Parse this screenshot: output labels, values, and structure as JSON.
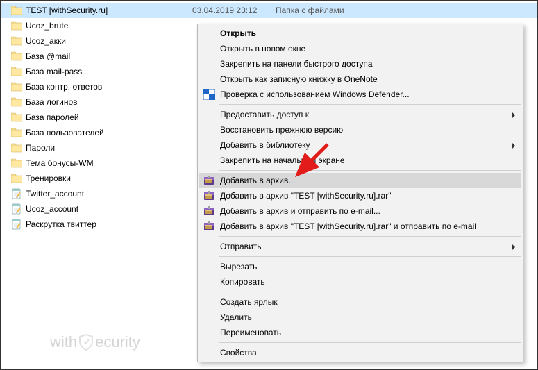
{
  "selected": {
    "name": "TEST [withSecurity.ru]",
    "date": "03.04.2019 23:12",
    "type": "Папка с файлами"
  },
  "files": [
    {
      "name": "TEST [withSecurity.ru]",
      "icon": "folder",
      "selected": true
    },
    {
      "name": "Ucoz_brute",
      "icon": "folder"
    },
    {
      "name": "Ucoz_акки",
      "icon": "folder"
    },
    {
      "name": "База @mail",
      "icon": "folder"
    },
    {
      "name": "База mail-pass",
      "icon": "folder"
    },
    {
      "name": "База контр. ответов",
      "icon": "folder"
    },
    {
      "name": "База логинов",
      "icon": "folder"
    },
    {
      "name": "База паролей",
      "icon": "folder"
    },
    {
      "name": "База пользователей",
      "icon": "folder"
    },
    {
      "name": "Пароли",
      "icon": "folder"
    },
    {
      "name": "Тема бонусы-WM",
      "icon": "folder"
    },
    {
      "name": "Тренировки",
      "icon": "folder"
    },
    {
      "name": "Twitter_account",
      "icon": "note"
    },
    {
      "name": "Ucoz_account",
      "icon": "note"
    },
    {
      "name": "Раскрутка твиттер",
      "icon": "note"
    }
  ],
  "menu": [
    {
      "label": "Открыть",
      "bold": true
    },
    {
      "label": "Открыть в новом окне"
    },
    {
      "label": "Закрепить на панели быстрого доступа"
    },
    {
      "label": "Открыть как записную книжку в OneNote"
    },
    {
      "label": "Проверка с использованием Windows Defender...",
      "icon": "defender"
    },
    {
      "label": "Предоставить доступ к",
      "sepBefore": true,
      "submenu": true
    },
    {
      "label": "Восстановить прежнюю версию"
    },
    {
      "label": "Добавить в библиотеку",
      "submenu": true
    },
    {
      "label": "Закрепить на начальном экране"
    },
    {
      "label": "Добавить в архив...",
      "sepBefore": true,
      "icon": "winrar",
      "highlight": true
    },
    {
      "label": "Добавить в архив \"TEST [withSecurity.ru].rar\"",
      "icon": "winrar"
    },
    {
      "label": "Добавить в архив и отправить по e-mail...",
      "icon": "winrar"
    },
    {
      "label": "Добавить в архив \"TEST [withSecurity.ru].rar\" и отправить по e-mail",
      "icon": "winrar"
    },
    {
      "label": "Отправить",
      "sepBefore": true,
      "submenu": true
    },
    {
      "label": "Вырезать",
      "sepBefore": true
    },
    {
      "label": "Копировать"
    },
    {
      "label": "Создать ярлык",
      "sepBefore": true
    },
    {
      "label": "Удалить"
    },
    {
      "label": "Переименовать"
    },
    {
      "label": "Свойства",
      "sepBefore": true
    }
  ],
  "watermark": {
    "prefix": "with",
    "suffix": "ecurity"
  }
}
